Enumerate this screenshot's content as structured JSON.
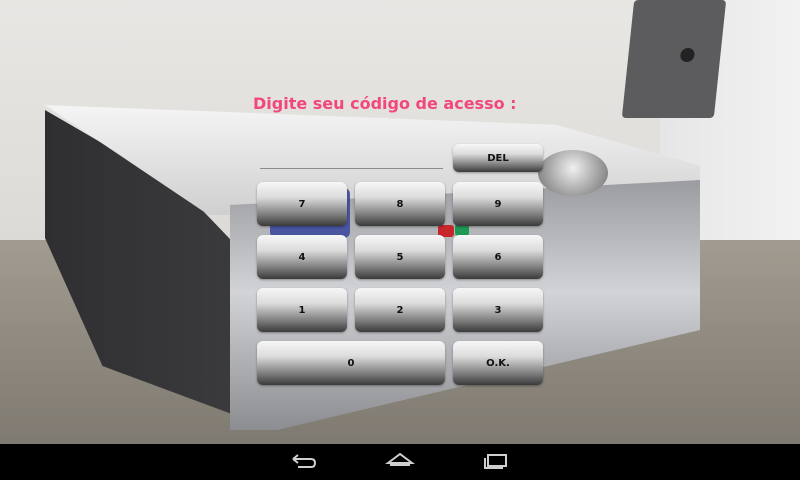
{
  "prompt": {
    "text": "Digite seu código de acesso  :"
  },
  "code_field": {
    "value": ""
  },
  "keypad": {
    "del": "DEL",
    "k7": "7",
    "k8": "8",
    "k9": "9",
    "k4": "4",
    "k5": "5",
    "k6": "6",
    "k1": "1",
    "k2": "2",
    "k3": "3",
    "k0": "0",
    "ok": "O.K."
  },
  "navbar": {
    "icons": [
      "back-icon",
      "home-icon",
      "recent-apps-icon"
    ]
  },
  "colors": {
    "prompt": "#f2477d",
    "navbar": "#000000"
  }
}
